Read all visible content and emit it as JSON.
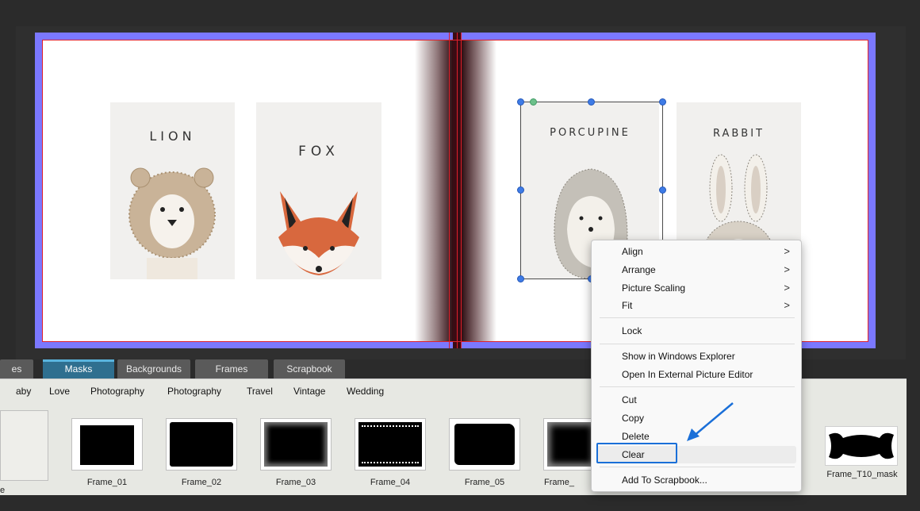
{
  "album": {
    "left_page": {
      "cards": [
        {
          "title": "LION",
          "animal": "lion"
        },
        {
          "title": "FOX",
          "animal": "fox"
        }
      ]
    },
    "right_page": {
      "cards": [
        {
          "title": "PORCUPINE",
          "animal": "porcupine",
          "selected": true
        },
        {
          "title": "RABBIT",
          "animal": "rabbit"
        }
      ]
    }
  },
  "tabs": [
    {
      "label": "es",
      "active": false
    },
    {
      "label": "Masks",
      "active": true
    },
    {
      "label": "Backgrounds",
      "active": false
    },
    {
      "label": "Frames",
      "active": false
    },
    {
      "label": "Scrapbook",
      "active": false
    }
  ],
  "categories": [
    "aby",
    "Love",
    "Photography",
    "Photography",
    "Travel",
    "Vintage",
    "Wedding"
  ],
  "thumbnails": [
    {
      "label": "ne"
    },
    {
      "label": "Frame_01"
    },
    {
      "label": "Frame_02"
    },
    {
      "label": "Frame_03"
    },
    {
      "label": "Frame_04"
    },
    {
      "label": "Frame_05"
    },
    {
      "label": "Frame_"
    },
    {
      "label": "Frame_T10_mask"
    }
  ],
  "context_menu": {
    "items": [
      {
        "label": "Align",
        "submenu": true
      },
      {
        "label": "Arrange",
        "submenu": true
      },
      {
        "label": "Picture Scaling",
        "submenu": true
      },
      {
        "label": "Fit",
        "submenu": true
      },
      {
        "label": "Lock",
        "submenu": false
      },
      {
        "label": "Show in Windows Explorer",
        "submenu": false
      },
      {
        "label": "Open In External Picture Editor",
        "submenu": false
      },
      {
        "label": "Cut",
        "submenu": false
      },
      {
        "label": "Copy",
        "submenu": false
      },
      {
        "label": "Delete",
        "submenu": false
      },
      {
        "label": "Clear",
        "submenu": false,
        "highlighted": true
      },
      {
        "label": "Add To Scrapbook...",
        "submenu": false
      }
    ],
    "chevron": ">"
  },
  "colors": {
    "spread_border": "#7b78ff",
    "active_tab": "#2f6f8f",
    "highlight_box": "#1a6fd8",
    "arrow": "#1a6fd8"
  }
}
